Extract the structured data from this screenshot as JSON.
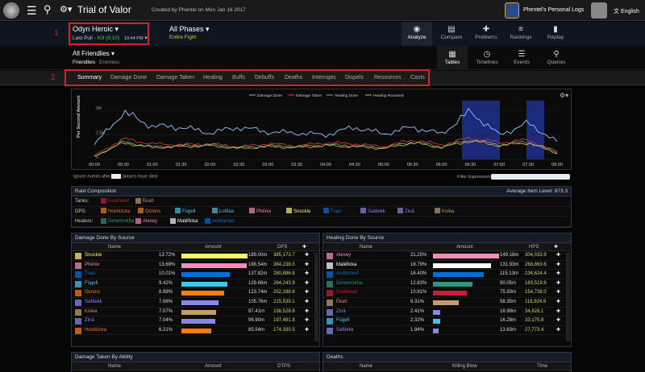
{
  "topbar": {
    "title": "Trial of Valor",
    "created": "Created by Phentei on Mon Jan 16 2017",
    "logs": "Phentel's Personal Logs",
    "lang": "English"
  },
  "header": {
    "fight": "Odyn Heroic",
    "pull_prefix": "Last Pull - ",
    "kill": "Kill (8:10)",
    "time": "10:44 PM",
    "phases": "All Phases",
    "phase_sub": "Entire Fight"
  },
  "views": [
    {
      "label": "Analyze",
      "icon": "◉"
    },
    {
      "label": "Compare",
      "icon": "▤"
    },
    {
      "label": "Problems",
      "icon": "✚"
    },
    {
      "label": "Rankings",
      "icon": "≡"
    },
    {
      "label": "Replay",
      "icon": "▮"
    }
  ],
  "friendlies": {
    "title": "All Friendlies",
    "a": "Friendlies",
    "b": "Enemies"
  },
  "subviews": [
    {
      "label": "Tables",
      "icon": "▦"
    },
    {
      "label": "Timelines",
      "icon": "◷"
    },
    {
      "label": "Events",
      "icon": "☰"
    },
    {
      "label": "Queries",
      "icon": "⚲"
    }
  ],
  "subnav": [
    "Summary",
    "Damage Done",
    "Damage Taken",
    "Healing",
    "Buffs",
    "Debuffs",
    "Deaths",
    "Interrupts",
    "Dispels",
    "Resources",
    "Casts"
  ],
  "annotations": {
    "one": "1",
    "two": "2"
  },
  "graph": {
    "legend": [
      "Damage Done",
      "Damage Taken",
      "Healing Done",
      "Healing Received"
    ],
    "ylabel": "Per Second Amount",
    "yticks": [
      "5M",
      "2.5M",
      "0"
    ],
    "xticks": [
      "00:00",
      "00:30",
      "01:00",
      "01:30",
      "02:00",
      "02:30",
      "03:00",
      "03:30",
      "04:00",
      "04:30",
      "05:00",
      "05:30",
      "06:00",
      "06:30",
      "07:00",
      "07:30",
      "08:00"
    ],
    "ignore_a": "Ignore events after",
    "ignore_b": "players have died",
    "filter": "Filter Expression:"
  },
  "chart_data": {
    "type": "line",
    "x": [
      "00:00",
      "00:30",
      "01:00",
      "01:30",
      "02:00",
      "02:30",
      "03:00",
      "03:30",
      "04:00",
      "04:30",
      "05:00",
      "05:30",
      "06:00",
      "06:30",
      "07:00",
      "07:30",
      "08:00"
    ],
    "series": [
      {
        "name": "Damage Done",
        "values": [
          1.5,
          4.8,
          3.4,
          3.3,
          2.7,
          3.3,
          2.8,
          2.7,
          2.5,
          3.3,
          2.6,
          3.3,
          2.6,
          4.9,
          2.5,
          3.7,
          1.8
        ]
      },
      {
        "name": "Damage Taken",
        "values": [
          0.4,
          2.1,
          1.6,
          1.5,
          1.6,
          1.3,
          1.6,
          1.4,
          1.7,
          1.6,
          1.3,
          2.0,
          1.5,
          2.2,
          1.7,
          2.0,
          0.8
        ]
      },
      {
        "name": "Healing Done",
        "values": [
          0.3,
          1.8,
          1.3,
          1.4,
          1.5,
          1.2,
          1.4,
          1.3,
          1.5,
          1.4,
          1.2,
          1.8,
          1.3,
          2.0,
          1.5,
          1.8,
          0.7
        ]
      },
      {
        "name": "Healing Received",
        "values": [
          0.3,
          1.7,
          1.2,
          1.3,
          1.4,
          1.1,
          1.3,
          1.2,
          1.4,
          1.3,
          1.1,
          1.7,
          1.2,
          1.9,
          1.4,
          1.7,
          0.6
        ]
      }
    ],
    "ylim": [
      0,
      6
    ]
  },
  "raid": {
    "title": "Raid Composition",
    "ilvl": "Average Item Level: 873.3",
    "tanks_label": "Tanks:",
    "dps_label": "DPS:",
    "healers_label": "Healers:",
    "tanks": [
      {
        "n": "Deathearl",
        "c": "#c41e3a"
      },
      {
        "n": "Ekah",
        "c": "#c69b6d"
      }
    ],
    "dps": [
      {
        "n": "Hoshizora",
        "c": "#ff7c0a"
      },
      {
        "n": "Ocrons",
        "c": "#ff7c0a"
      },
      {
        "n": "Fügell",
        "c": "#3fc7eb"
      },
      {
        "n": "Lotfiaa",
        "c": "#3fc7eb"
      },
      {
        "n": "Phénix",
        "c": "#f48cba"
      },
      {
        "n": "Snockie",
        "c": "#fff468"
      },
      {
        "n": "Trian",
        "c": "#0070dd"
      },
      {
        "n": "Safdekk",
        "c": "#8788ee"
      },
      {
        "n": "Zinä",
        "c": "#8788ee"
      },
      {
        "n": "Kolea",
        "c": "#c69b6d"
      }
    ],
    "healers": [
      {
        "n": "Denemokha",
        "c": "#33937f"
      },
      {
        "n": "Alexey",
        "c": "#f48cba"
      },
      {
        "n": "Maléficka",
        "c": "#ffffff"
      },
      {
        "n": "Andromed",
        "c": "#0070dd"
      }
    ]
  },
  "damage_done": {
    "title": "Damage Done By Source",
    "cols": [
      "Name",
      "Amount",
      "DPS"
    ],
    "rows": [
      {
        "n": "Snockie",
        "c": "#fff468",
        "p": "13.72%",
        "a": "189.00m",
        "d": "385,173.7",
        "f": 1.0
      },
      {
        "n": "Phénix",
        "c": "#f48cba",
        "p": "13.69%",
        "a": "188.54m",
        "d": "384,238.0",
        "f": 0.99
      },
      {
        "n": "Trian",
        "c": "#0070dd",
        "p": "10.01%",
        "a": "137.82m",
        "d": "280,886.8",
        "f": 0.73
      },
      {
        "n": "Fügell",
        "c": "#3fc7eb",
        "p": "9.42%",
        "a": "129.66m",
        "d": "264,243.9",
        "f": 0.69
      },
      {
        "n": "Ocrons",
        "c": "#ff7c0a",
        "p": "8.99%",
        "a": "123.74m",
        "d": "252,188.8",
        "f": 0.65
      },
      {
        "n": "Safdekk",
        "c": "#8788ee",
        "p": "7.68%",
        "a": "105.76m",
        "d": "215,539.1",
        "f": 0.56
      },
      {
        "n": "Kolea",
        "c": "#c69b6d",
        "p": "7.07%",
        "a": "97.41m",
        "d": "198,528.8",
        "f": 0.52
      },
      {
        "n": "Zinä",
        "c": "#8788ee",
        "p": "7.04%",
        "a": "96.90m",
        "d": "197,481.8",
        "f": 0.51
      },
      {
        "n": "Hoshizora",
        "c": "#ff7c0a",
        "p": "6.21%",
        "a": "85.54m",
        "d": "174,330.5",
        "f": 0.45
      }
    ]
  },
  "healing_done": {
    "title": "Healing Done By Source",
    "cols": [
      "Name",
      "Amount",
      "HPS"
    ],
    "rows": [
      {
        "n": "Alexey",
        "c": "#f48cba",
        "p": "21.25%",
        "a": "149.18m",
        "d": "304,033.9",
        "f": 1.0
      },
      {
        "n": "Maléficka",
        "c": "#ffffff",
        "p": "18.79%",
        "a": "131.93m",
        "d": "268,863.6",
        "f": 0.88
      },
      {
        "n": "Andromed",
        "c": "#0070dd",
        "p": "16.40%",
        "a": "115.13m",
        "d": "234,624.4",
        "f": 0.77
      },
      {
        "n": "Denemokha",
        "c": "#33937f",
        "p": "12.83%",
        "a": "90.05m",
        "d": "183,519.9",
        "f": 0.6
      },
      {
        "n": "Deathearl",
        "c": "#c41e3a",
        "p": "10.81%",
        "a": "75.93m",
        "d": "154,738.0",
        "f": 0.51
      },
      {
        "n": "Ekah",
        "c": "#c69b6d",
        "p": "8.31%",
        "a": "58.35m",
        "d": "118,924.9",
        "f": 0.39
      },
      {
        "n": "Zinä",
        "c": "#8788ee",
        "p": "2.41%",
        "a": "16.99m",
        "d": "34,628.1",
        "f": 0.11
      },
      {
        "n": "Fügell",
        "c": "#3fc7eb",
        "p": "2.32%",
        "a": "16.28m",
        "d": "33,175.8",
        "f": 0.11
      },
      {
        "n": "Safdekk",
        "c": "#8788ee",
        "p": "1.94%",
        "a": "13.63m",
        "d": "27,773.4",
        "f": 0.09
      }
    ]
  },
  "dmg_taken": {
    "title": "Damage Taken By Ability",
    "cols": [
      "Name",
      "Amount",
      "DTPS"
    ]
  },
  "deaths": {
    "title": "Deaths",
    "cols": [
      "Name",
      "Killing Blow",
      "Time"
    ]
  }
}
